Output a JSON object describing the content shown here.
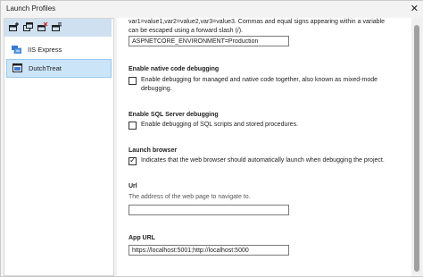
{
  "window": {
    "title": "Launch Profiles",
    "close_glyph": "✕"
  },
  "toolbar": {
    "buttons": [
      {
        "icon": "new-profile-icon"
      },
      {
        "icon": "copy-profile-icon"
      },
      {
        "icon": "delete-profile-icon"
      },
      {
        "icon": "rename-profile-icon"
      }
    ]
  },
  "profiles": [
    {
      "label": "IIS Express",
      "selected": false,
      "icon": "iis-icon"
    },
    {
      "label": "DutchTreat",
      "selected": true,
      "icon": "project-icon"
    }
  ],
  "env_vars": {
    "help": "var1=value1,var2=value2,var3=value3. Commas and equal signs appearing within a variable can be escaped using a forward slash (/).",
    "value": "ASPNETCORE_ENVIRONMENT=Production"
  },
  "native_debug": {
    "label": "Enable native code debugging",
    "text": "Enable debugging for managed and native code together, also known as mixed-mode debugging.",
    "checked": false
  },
  "sql_debug": {
    "label": "Enable SQL Server debugging",
    "text": "Enable debugging of SQL scripts and stored procedures.",
    "checked": false
  },
  "launch_browser": {
    "label": "Launch browser",
    "text": "Indicates that the web browser should automatically launch when debugging the project.",
    "checked": true
  },
  "url": {
    "label": "Url",
    "help": "The address of the web page to navigate to.",
    "value": ""
  },
  "app_url": {
    "label": "App URL",
    "value": "https://localhost:5001;http://localhost:5000"
  }
}
